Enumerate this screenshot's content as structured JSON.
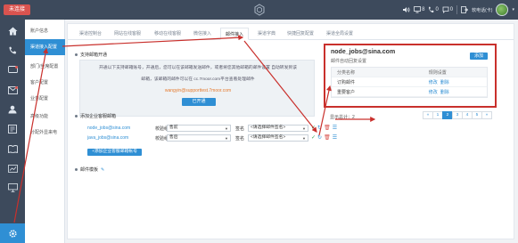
{
  "topbar": {
    "status_button": "未连接",
    "extension_label": "软电话(卡)",
    "badges": {
      "monitor": "8",
      "phone": "0",
      "chat": "0"
    },
    "icons": [
      "volume-icon",
      "monitor-icon",
      "phone-icon",
      "chat-icon",
      "logout-icon"
    ]
  },
  "submenu": {
    "items": [
      {
        "label": "账户信息"
      },
      {
        "label": "渠道接入配置",
        "active": true
      },
      {
        "label": "部门/坐席配置"
      },
      {
        "label": "客户配置"
      },
      {
        "label": "业务配置"
      },
      {
        "label": "高级功能"
      },
      {
        "label": "分配外显来电"
      }
    ]
  },
  "tabs": [
    {
      "label": "渠道控制台"
    },
    {
      "label": "网站在线客服"
    },
    {
      "label": "移动在线客服"
    },
    {
      "label": "微信接入"
    },
    {
      "label": "邮件接入",
      "active": true
    },
    {
      "label": "渠道字典"
    },
    {
      "label": "快捷回复配置"
    },
    {
      "label": "渠道全局设置"
    }
  ],
  "support": {
    "title": "支持邮箱开通",
    "line1": "开通以下支持邮箱账号，开通后，您可以在该邮箱发送邮件，或者将您其他邮箱的邮件设置 自动转发到该",
    "line2": "邮箱，该邮箱的邮件可以在 cc.7moor.com平台查看处理邮件",
    "mail": "wangyin@supporttest.7moor.com",
    "open_button": "已开通"
  },
  "enterprise": {
    "title": "添加企业客服邮箱",
    "verify_label": "校验组",
    "sig_label": "签名",
    "rows": [
      {
        "email": "node_jobs@sina.com",
        "verify": "售前",
        "signature": "<请选择邮件签名>"
      },
      {
        "email": "java_jobs@sina.com",
        "verify": "售后",
        "signature": "<请选择邮件签名>"
      }
    ],
    "add_button": "+添加企业客服邮箱帐号"
  },
  "template": {
    "title": "邮件模板"
  },
  "detail_panel": {
    "title": "node_jobs@sina.com",
    "subtitle": "邮件自动回复设置",
    "add_button": "添加",
    "headers": [
      "分类名称",
      "规则设置"
    ],
    "rows": [
      {
        "name": "订购邮件",
        "edit": "修改",
        "delete": "删除"
      },
      {
        "name": "重要客户",
        "edit": "修改",
        "delete": "删除"
      }
    ]
  },
  "pagination": {
    "total": "显示总计：2",
    "pages": [
      "«",
      "1",
      "2",
      "3",
      "4",
      "5",
      "»"
    ],
    "active_page": "2"
  }
}
